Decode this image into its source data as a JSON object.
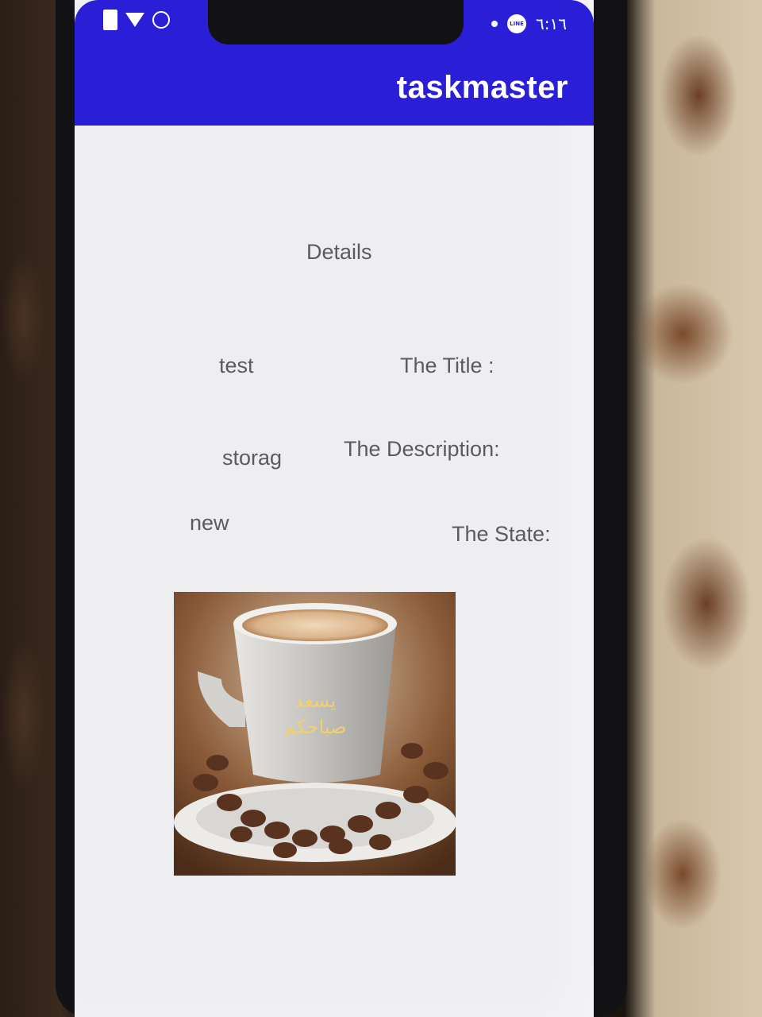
{
  "statusbar": {
    "time": "٦:١٦",
    "line_badge": "LINE"
  },
  "appbar": {
    "title": "taskmaster"
  },
  "details": {
    "heading": "Details",
    "title_label": "The Title :",
    "title_value": "test",
    "description_label": "The Description:",
    "description_value": "storag",
    "state_label": "The State:",
    "state_value": "new"
  },
  "image": {
    "caption_line1": "يسعد",
    "caption_line2": "صباحكم"
  },
  "colors": {
    "appbar": "#2a1fd6",
    "background": "#eeeef1",
    "text": "#5a5a62"
  }
}
